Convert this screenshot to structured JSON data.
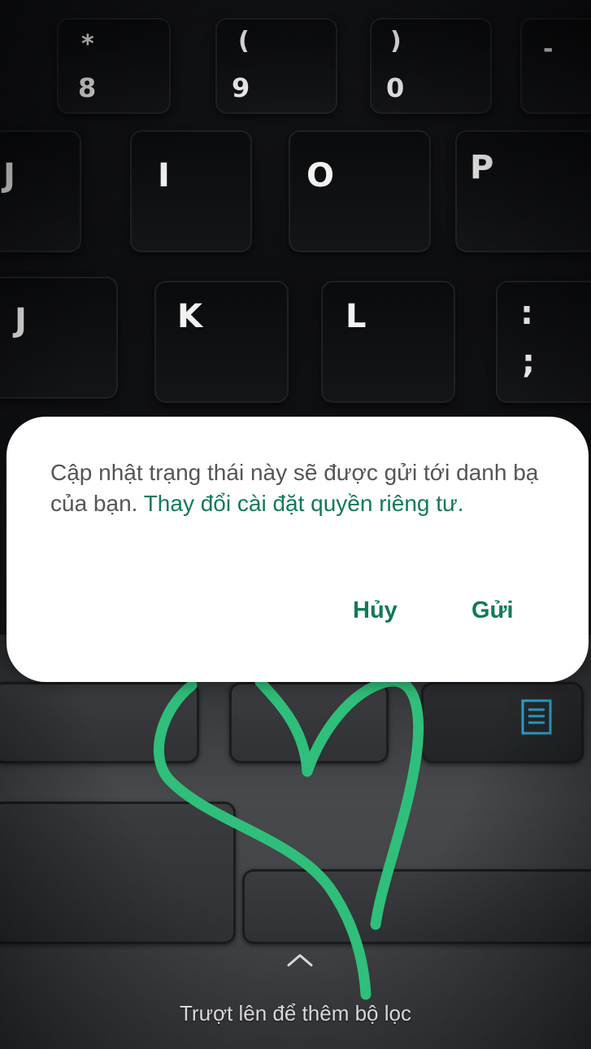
{
  "background": {
    "keys_top": [
      {
        "label": "*",
        "sub": "8"
      },
      {
        "label": "(",
        "sub": "9"
      },
      {
        "label": ")",
        "sub": "0"
      },
      {
        "label": "-"
      }
    ],
    "keys_mid": [
      "J",
      "I",
      "O",
      "P"
    ],
    "keys_row3": [
      "J",
      "K",
      "L",
      ":"
    ],
    "semicolon": ";"
  },
  "dialog": {
    "message": "Cập nhật trạng thái này sẽ được gửi tới danh bạ của bạn. ",
    "link": "Thay đổi cài đặt quyền riêng tư.",
    "cancel_label": "Hủy",
    "send_label": "Gửi"
  },
  "footer": {
    "swipe_hint": "Trượt lên để thêm bộ lọc"
  },
  "colors": {
    "accent": "#0f7a5a",
    "drawing": "#2fbf7a",
    "icon_blue": "#2aa7d6"
  },
  "icons": {
    "swipe": "chevron-up-icon",
    "key_glyph": "document-icon"
  }
}
